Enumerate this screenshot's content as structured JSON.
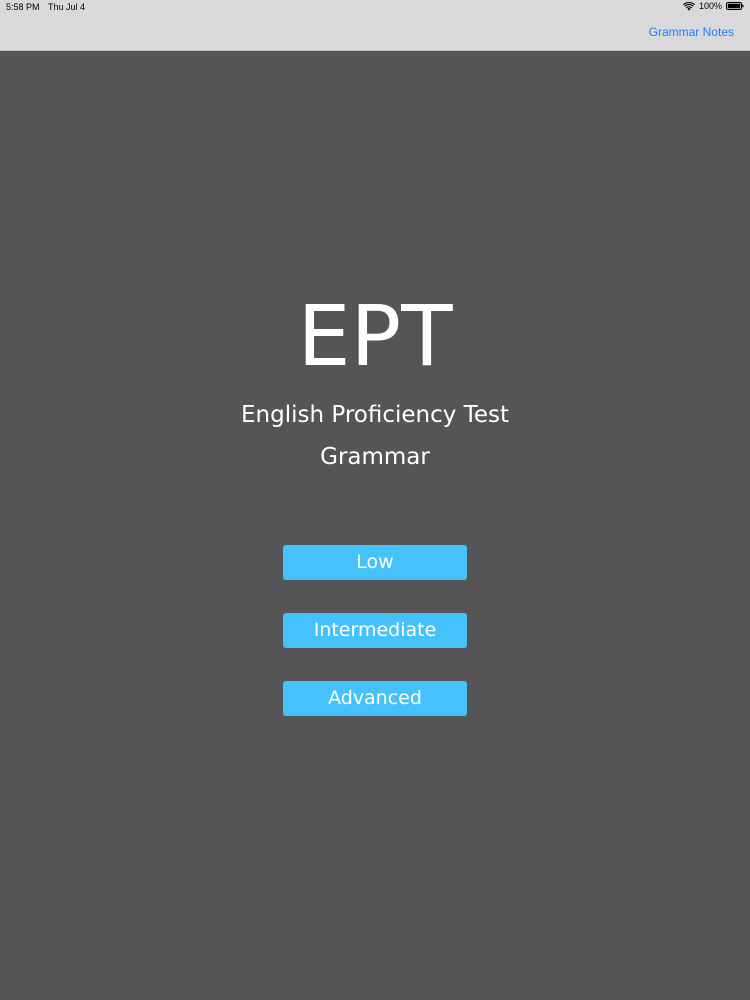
{
  "status_bar": {
    "time": "5:58 PM",
    "date": "Thu Jul 4",
    "battery": "100%"
  },
  "nav": {
    "grammar_notes_label": "Grammar Notes"
  },
  "main": {
    "title": "EPT",
    "subtitle_line1": "English Proficiency Test",
    "subtitle_line2": "Grammar",
    "buttons": {
      "low": "Low",
      "intermediate": "Intermediate",
      "advanced": "Advanced"
    }
  },
  "colors": {
    "background": "#555557",
    "topbar": "#d9d9db",
    "accent_link": "#1e7ef5",
    "button": "#45c2fb",
    "text": "#ffffff"
  },
  "icons": {
    "wifi": "wifi-icon",
    "battery": "battery-icon"
  }
}
